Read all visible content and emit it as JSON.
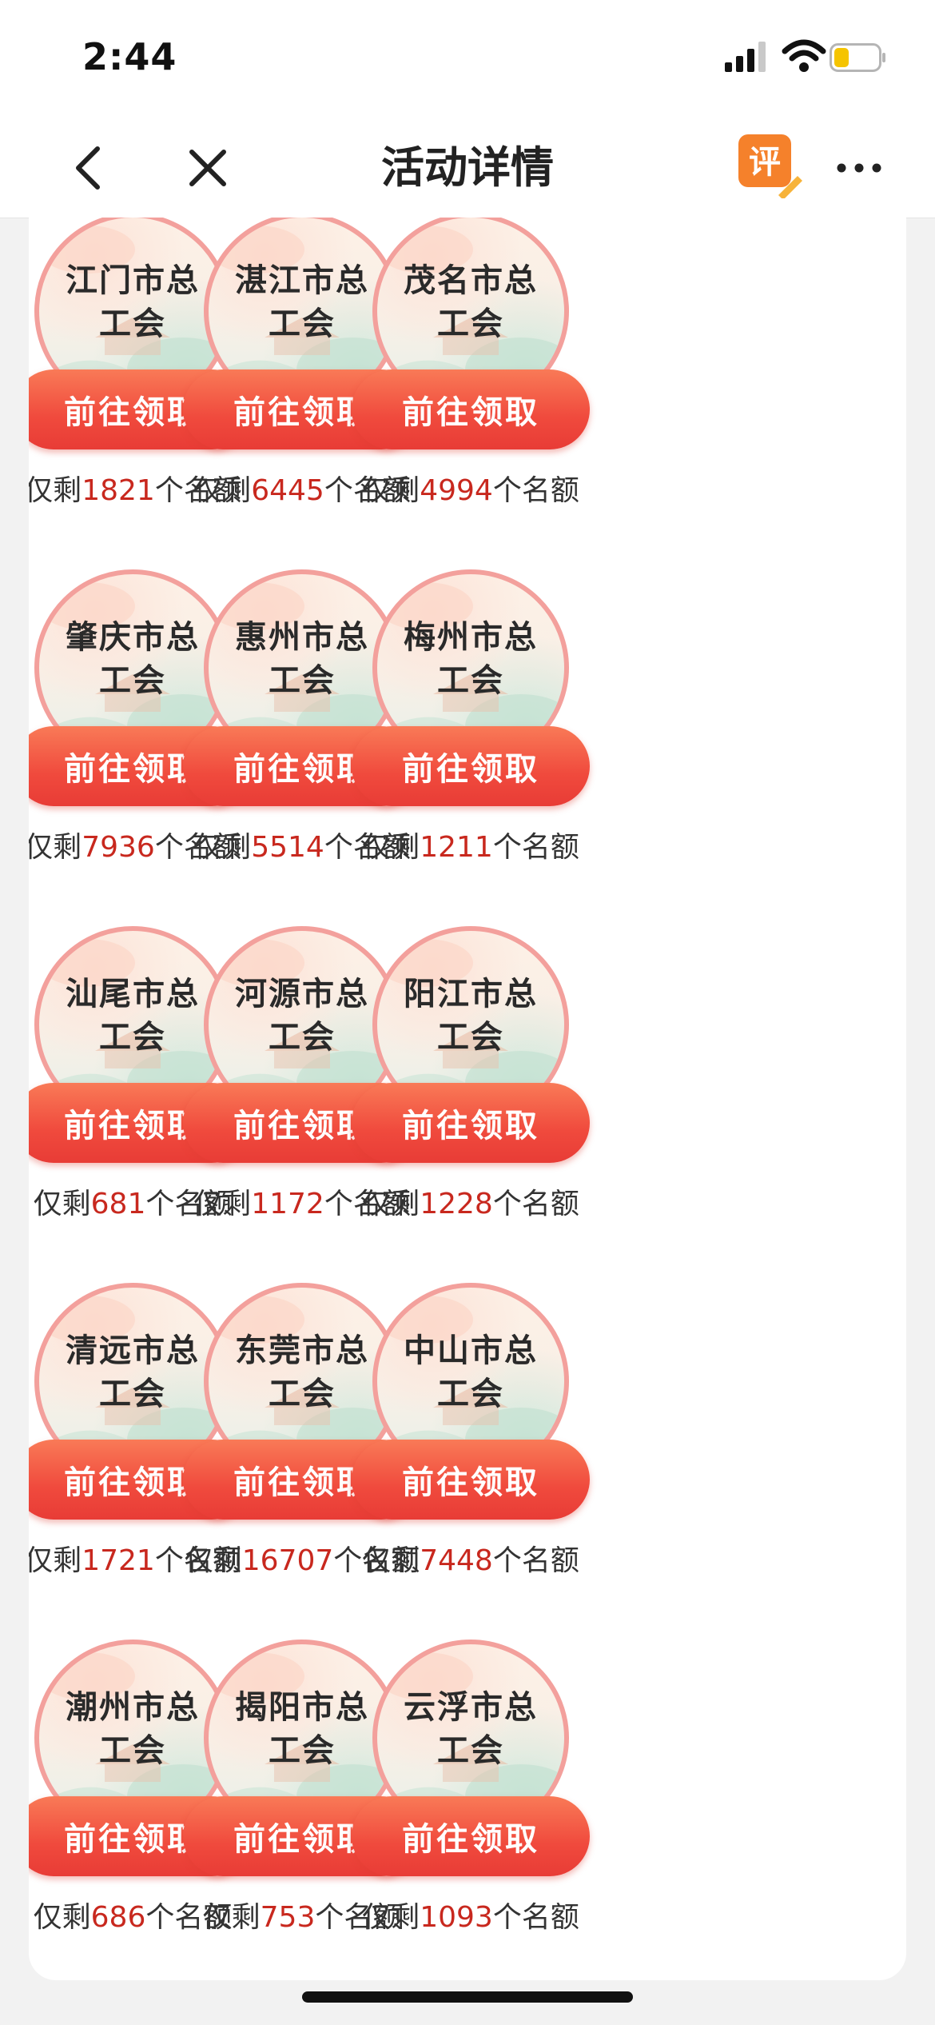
{
  "status_bar": {
    "time": "2:44",
    "battery_color": "#f5c400"
  },
  "nav": {
    "title": "活动详情",
    "review_badge": "评",
    "back_icon": "chevron-left-icon",
    "close_icon": "close-icon",
    "more_icon": "more-dots-icon"
  },
  "grid": {
    "button_label": "前往领取",
    "quota_prefix": "仅剩",
    "quota_suffix": "个名额",
    "items": [
      {
        "name": "江门市总工会",
        "count": "1821"
      },
      {
        "name": "湛江市总工会",
        "count": "6445"
      },
      {
        "name": "茂名市总工会",
        "count": "4994"
      },
      {
        "name": "肇庆市总工会",
        "count": "7936"
      },
      {
        "name": "惠州市总工会",
        "count": "5514"
      },
      {
        "name": "梅州市总工会",
        "count": "1211"
      },
      {
        "name": "汕尾市总工会",
        "count": "681"
      },
      {
        "name": "河源市总工会",
        "count": "1172"
      },
      {
        "name": "阳江市总工会",
        "count": "1228"
      },
      {
        "name": "清远市总工会",
        "count": "1721"
      },
      {
        "name": "东莞市总工会",
        "count": "16707"
      },
      {
        "name": "中山市总工会",
        "count": "7448"
      },
      {
        "name": "潮州市总工会",
        "count": "686"
      },
      {
        "name": "揭阳市总工会",
        "count": "753"
      },
      {
        "name": "云浮市总工会",
        "count": "1093"
      }
    ]
  },
  "colors": {
    "accent": "#f04a3d",
    "count": "#c8281e",
    "ring": "#f3a09c"
  }
}
